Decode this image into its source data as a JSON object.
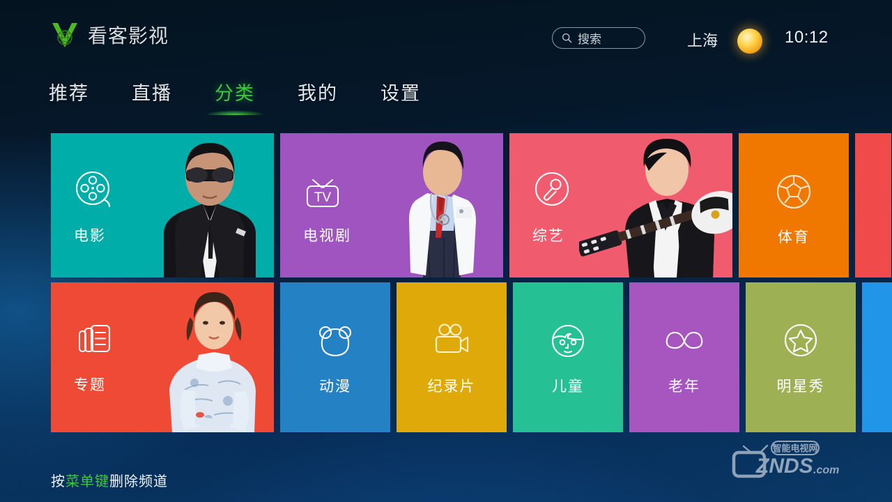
{
  "header": {
    "brand_logo_icon": "v-globe-logo-icon",
    "brand_name": "看客影视",
    "search": {
      "icon": "search-icon",
      "label": "搜索",
      "placeholder": "搜索"
    },
    "city": "上海",
    "weather_icon": "sun-icon",
    "time": "10:12"
  },
  "nav": {
    "items": [
      {
        "label": "推荐",
        "active": false
      },
      {
        "label": "直播",
        "active": false
      },
      {
        "label": "分类",
        "active": true
      },
      {
        "label": "我的",
        "active": false
      },
      {
        "label": "设置",
        "active": false
      }
    ],
    "active_color": "#3fc53f"
  },
  "grid": {
    "row1": [
      {
        "label": "电影",
        "icon": "film-reel-icon",
        "color": "#00ada9",
        "size": "wide",
        "photo": "man-in-suit-sunglasses"
      },
      {
        "label": "电视剧",
        "icon": "tv-icon",
        "color": "#a054c0",
        "size": "wide",
        "photo": "doctor-with-stethoscope"
      },
      {
        "label": "综艺",
        "icon": "microphone-icon",
        "color": "#f05b6e",
        "size": "wide",
        "photo": "singer-with-guitar"
      },
      {
        "label": "体育",
        "icon": "soccer-ball-icon",
        "color": "#f07800",
        "size": "narrow",
        "photo": ""
      },
      {
        "label": "",
        "icon": "",
        "color": "#f04a4a",
        "size": "edge",
        "photo": ""
      }
    ],
    "row2": [
      {
        "label": "专题",
        "icon": "stacked-cards-icon",
        "color": "#ef4a36",
        "size": "wide",
        "photo": "woman-in-traditional-dress"
      },
      {
        "label": "动漫",
        "icon": "bear-head-icon",
        "color": "#2481c4",
        "size": "narrow",
        "photo": ""
      },
      {
        "label": "纪录片",
        "icon": "video-camera-icon",
        "color": "#dfaa09",
        "size": "narrow",
        "photo": ""
      },
      {
        "label": "儿童",
        "icon": "child-face-icon",
        "color": "#25c195",
        "size": "narrow",
        "photo": ""
      },
      {
        "label": "老年",
        "icon": "mustache-icon",
        "color": "#a756bf",
        "size": "narrow",
        "photo": ""
      },
      {
        "label": "明星秀",
        "icon": "star-circle-icon",
        "color": "#9db054",
        "size": "narrow",
        "photo": ""
      },
      {
        "label": "",
        "icon": "",
        "color": "#2196e8",
        "size": "edge",
        "photo": ""
      }
    ]
  },
  "footer": {
    "hint_prefix": "按",
    "hint_key": "菜单键",
    "hint_suffix": "删除频道"
  },
  "watermark": {
    "tagline": "智能电视网",
    "brand": "ZNDS",
    "tld": ".com",
    "icon": "tv-watermark-icon"
  }
}
